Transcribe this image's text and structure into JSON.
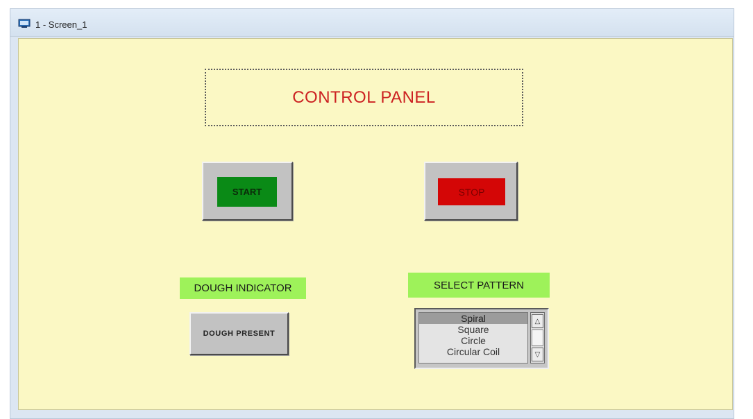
{
  "window": {
    "title": "1 - Screen_1",
    "icon": "monitor-icon"
  },
  "panel": {
    "title": "CONTROL PANEL"
  },
  "buttons": {
    "start_label": "START",
    "stop_label": "STOP",
    "dough_present_label": "DOUGH PRESENT"
  },
  "labels": {
    "dough_indicator": "DOUGH INDICATOR",
    "select_pattern": "SELECT PATTERN"
  },
  "pattern_list": {
    "items": [
      "Spiral",
      "Square",
      "Circle",
      "Circular Coil"
    ],
    "selected": "Spiral",
    "scroll_up_icon": "△",
    "scroll_down_icon": "▽"
  },
  "colors": {
    "canvas_background": "#fbf8c4",
    "title_text": "#cc2222",
    "start_button": "#0a8a16",
    "stop_button": "#d40606",
    "label_background": "#9ef25a"
  }
}
